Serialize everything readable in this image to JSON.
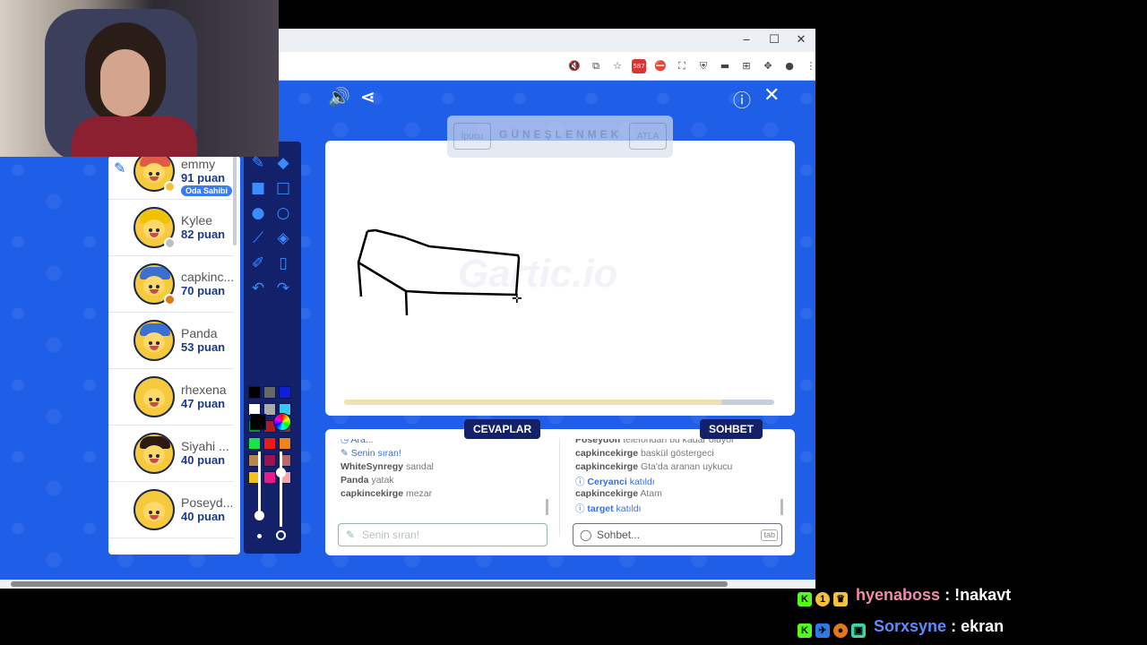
{
  "browser": {
    "window_controls": {
      "minimize": "‒",
      "maximize": "☐",
      "close": "✕"
    },
    "extensions": [
      {
        "name": "mute-icon",
        "glyph": "🔇"
      },
      {
        "name": "cast-icon",
        "glyph": "⧉"
      },
      {
        "name": "bookmark-star-icon",
        "glyph": "☆"
      },
      {
        "name": "extension-badge-icon",
        "glyph": "587"
      },
      {
        "name": "adblock-icon",
        "glyph": "⛔"
      },
      {
        "name": "screenshot-icon",
        "glyph": "⛶"
      },
      {
        "name": "shield-icon",
        "glyph": "⛨"
      },
      {
        "name": "battery-icon",
        "glyph": "▬"
      },
      {
        "name": "grid-icon",
        "glyph": "⊞"
      },
      {
        "name": "puzzle-icon",
        "glyph": "✥"
      },
      {
        "name": "profile-icon",
        "glyph": "●"
      },
      {
        "name": "menu-icon",
        "glyph": "⋮"
      }
    ]
  },
  "game": {
    "top_left_icons": {
      "sound": "🔊",
      "share": "⋖"
    },
    "top_right_icons": {
      "info": "ⓘ",
      "close": "✕"
    },
    "hint": {
      "hint_button": "İpucu",
      "word": "GÜNEŞLENMEK",
      "skip_button": "ATLA"
    },
    "watermark": "Gartic.io",
    "timer_progress": 0.88,
    "players": [
      {
        "name": "emmy",
        "score": "91 puan",
        "badge": "Oda Sahibi",
        "drawing": true,
        "status_color": "#f6c13a",
        "hair": "#e05a47"
      },
      {
        "name": "Kylee",
        "score": "82 puan",
        "status_color": "#bfbfbf",
        "hair": "#f2c200"
      },
      {
        "name": "capkinc...",
        "score": "70 puan",
        "status_color": "#e0781a",
        "hair": "#3b6fd1"
      },
      {
        "name": "Panda",
        "score": "53 puan",
        "status_color": "",
        "hair": "#3b6fd1"
      },
      {
        "name": "rhexena",
        "score": "47 puan",
        "status_color": "",
        "hair": "#f7c93d"
      },
      {
        "name": "Siyahi ...",
        "score": "40 puan",
        "status_color": "",
        "hair": "#2a1a12"
      },
      {
        "name": "Poseyd...",
        "score": "40 puan",
        "status_color": "",
        "hair": "#f7c93d"
      }
    ],
    "palette": [
      "#000000",
      "#666666",
      "#0c20d8",
      "#ffffff",
      "#aaaaaa",
      "#38c9f2",
      "#1a8a3a",
      "#b11d1d",
      "#8a3a1a",
      "#19e24a",
      "#ea1a1a",
      "#f2831a",
      "#b8864a",
      "#991450",
      "#b86a6a",
      "#f2c21a",
      "#ea1a8a",
      "#f2a6b0"
    ],
    "answers": {
      "tab_label": "CEVAPLAR",
      "lines": [
        {
          "user": "",
          "text": "Ara...",
          "type": "info"
        },
        {
          "user": "",
          "text": "Senin sıran!",
          "type": "turn"
        },
        {
          "user": "WhiteSynregy",
          "text": "sandal"
        },
        {
          "user": "Panda",
          "text": "yatak"
        },
        {
          "user": "capkincekirge",
          "text": "mezar"
        }
      ],
      "placeholder": "Senin sıran!"
    },
    "chat": {
      "tab_label": "SOHBET",
      "lines": [
        {
          "user": "Poseydon",
          "text": "telefondan bu kadar oluyor"
        },
        {
          "user": "capkincekirge",
          "text": "baskül göstergeci"
        },
        {
          "user": "capkincekirge",
          "text": "Gta'da aranan uykucu"
        },
        {
          "user": "Ceryanci",
          "text": "katıldı",
          "type": "join"
        },
        {
          "user": "capkincekirge",
          "text": "Atam"
        },
        {
          "user": "target",
          "text": "katıldı",
          "type": "join"
        }
      ],
      "placeholder": "Sohbet...",
      "tab_hint": "tab"
    }
  },
  "stream_chat": [
    {
      "user": "hyenaboss",
      "message": ": !nakavt",
      "user_color": "#f08ab0"
    },
    {
      "user": "Sorxsyne",
      "message": ": ekran",
      "user_color": "#5b8cff"
    }
  ]
}
